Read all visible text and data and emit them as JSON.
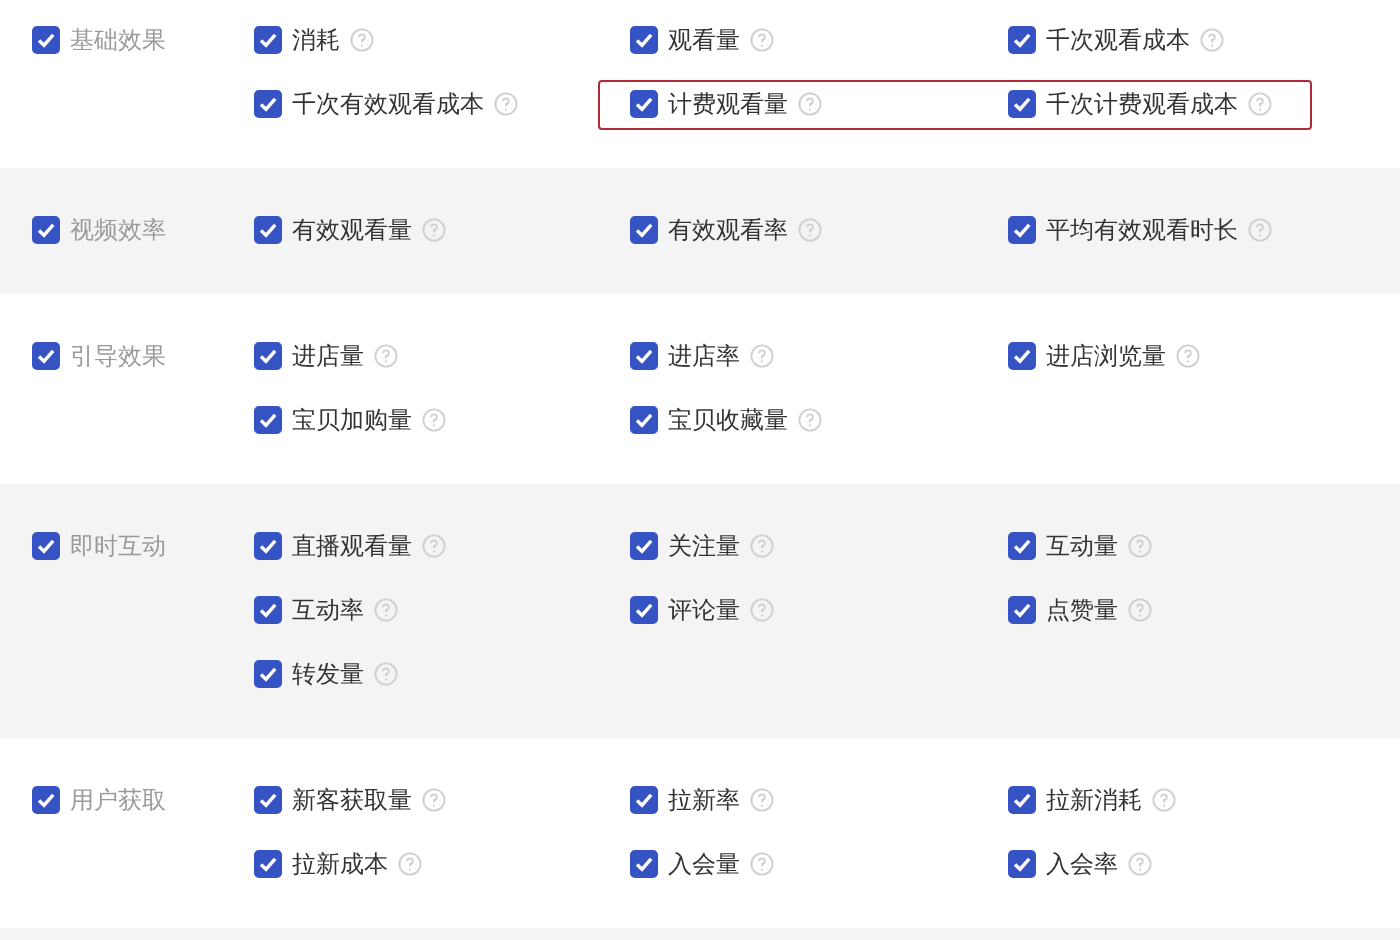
{
  "sections": [
    {
      "label": "基础效果",
      "checked": true,
      "items": [
        {
          "label": "消耗",
          "checked": true
        },
        {
          "label": "观看量",
          "checked": true
        },
        {
          "label": "千次观看成本",
          "checked": true
        },
        {
          "label": "千次有效观看成本",
          "checked": true
        },
        {
          "label": "计费观看量",
          "checked": true,
          "highlighted": true
        },
        {
          "label": "千次计费观看成本",
          "checked": true,
          "highlighted": true
        }
      ]
    },
    {
      "label": "视频效率",
      "checked": true,
      "items": [
        {
          "label": "有效观看量",
          "checked": true
        },
        {
          "label": "有效观看率",
          "checked": true
        },
        {
          "label": "平均有效观看时长",
          "checked": true
        }
      ]
    },
    {
      "label": "引导效果",
      "checked": true,
      "items": [
        {
          "label": "进店量",
          "checked": true
        },
        {
          "label": "进店率",
          "checked": true
        },
        {
          "label": "进店浏览量",
          "checked": true
        },
        {
          "label": "宝贝加购量",
          "checked": true
        },
        {
          "label": "宝贝收藏量",
          "checked": true
        }
      ]
    },
    {
      "label": "即时互动",
      "checked": true,
      "items": [
        {
          "label": "直播观看量",
          "checked": true
        },
        {
          "label": "关注量",
          "checked": true
        },
        {
          "label": "互动量",
          "checked": true
        },
        {
          "label": "互动率",
          "checked": true
        },
        {
          "label": "评论量",
          "checked": true
        },
        {
          "label": "点赞量",
          "checked": true
        },
        {
          "label": "转发量",
          "checked": true
        }
      ]
    },
    {
      "label": "用户获取",
      "checked": true,
      "items": [
        {
          "label": "新客获取量",
          "checked": true
        },
        {
          "label": "拉新率",
          "checked": true
        },
        {
          "label": "拉新消耗",
          "checked": true
        },
        {
          "label": "拉新成本",
          "checked": true
        },
        {
          "label": "入会量",
          "checked": true
        },
        {
          "label": "入会率",
          "checked": true
        }
      ]
    }
  ]
}
